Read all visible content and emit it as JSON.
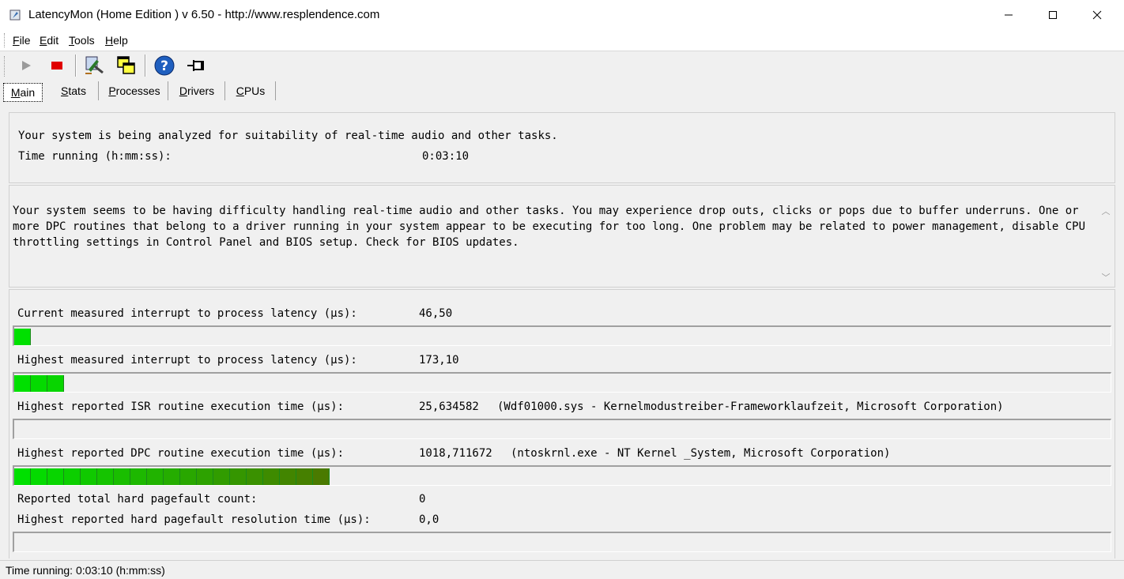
{
  "window": {
    "title": "LatencyMon  (Home Edition )  v 6.50 - http://www.resplendence.com"
  },
  "menu": [
    {
      "label": "File",
      "accel": "F",
      "rest": "ile"
    },
    {
      "label": "Edit",
      "accel": "E",
      "rest": "dit"
    },
    {
      "label": "Tools",
      "accel": "T",
      "rest": "ools"
    },
    {
      "label": "Help",
      "accel": "H",
      "rest": "elp"
    }
  ],
  "toolbar": {
    "icons": [
      "play-icon",
      "stop-icon",
      "analyze-icon",
      "windows-icon",
      "help-icon",
      "pin-icon"
    ],
    "colors": {
      "stop": "#e00000",
      "help": "#1f5fbf"
    }
  },
  "tabs": [
    {
      "label": "Main",
      "accel": "M",
      "rest": "ain",
      "active": true
    },
    {
      "label": "Stats",
      "accel": "S",
      "rest": "tats",
      "active": false
    },
    {
      "label": "Processes",
      "accel": "P",
      "rest": "rocesses",
      "active": false
    },
    {
      "label": "Drivers",
      "accel": "D",
      "rest": "rivers",
      "active": false
    },
    {
      "label": "CPUs",
      "accel": "C",
      "rest": "PUs",
      "active": false
    }
  ],
  "status_panel": {
    "line1": "Your system is being analyzed for suitability of real-time audio and other tasks.",
    "time_label": "Time running (h:mm:ss):",
    "time_value": "0:03:10"
  },
  "message": "Your system seems to be having difficulty handling real-time audio and other tasks. You may experience drop outs, clicks or pops due to buffer underruns. One or more DPC routines that belong to a driver running in your system appear to be executing for too long. One problem may be related to power management, disable CPU throttling settings in Control Panel and BIOS setup. Check for BIOS updates.",
  "metrics": [
    {
      "label": "Current measured interrupt to process latency (µs):",
      "value": "46,50",
      "detail": "",
      "segments": 1
    },
    {
      "label": "Highest measured interrupt to process latency (µs):",
      "value": "173,10",
      "detail": "",
      "segments": 3
    },
    {
      "label": "Highest reported ISR routine execution time (µs):",
      "value": "25,634582",
      "detail": "(Wdf01000.sys - Kernelmodustreiber-Frameworklaufzeit, Microsoft Corporation)",
      "segments": 0
    },
    {
      "label": "Highest reported DPC routine execution time (µs):",
      "value": "1018,711672",
      "detail": "(ntoskrnl.exe - NT Kernel _System, Microsoft Corporation)",
      "segments": 19
    },
    {
      "label": "Reported total hard pagefault count:",
      "value": "0",
      "detail": "",
      "segments": null
    },
    {
      "label": "Highest reported hard pagefault resolution time (µs):",
      "value": "0,0",
      "detail": "",
      "segments": 0
    }
  ],
  "bar_colors": {
    "start": "#00e000",
    "end": "#4a7a00"
  },
  "statusbar": {
    "text": "Time running: 0:03:10  (h:mm:ss)"
  }
}
